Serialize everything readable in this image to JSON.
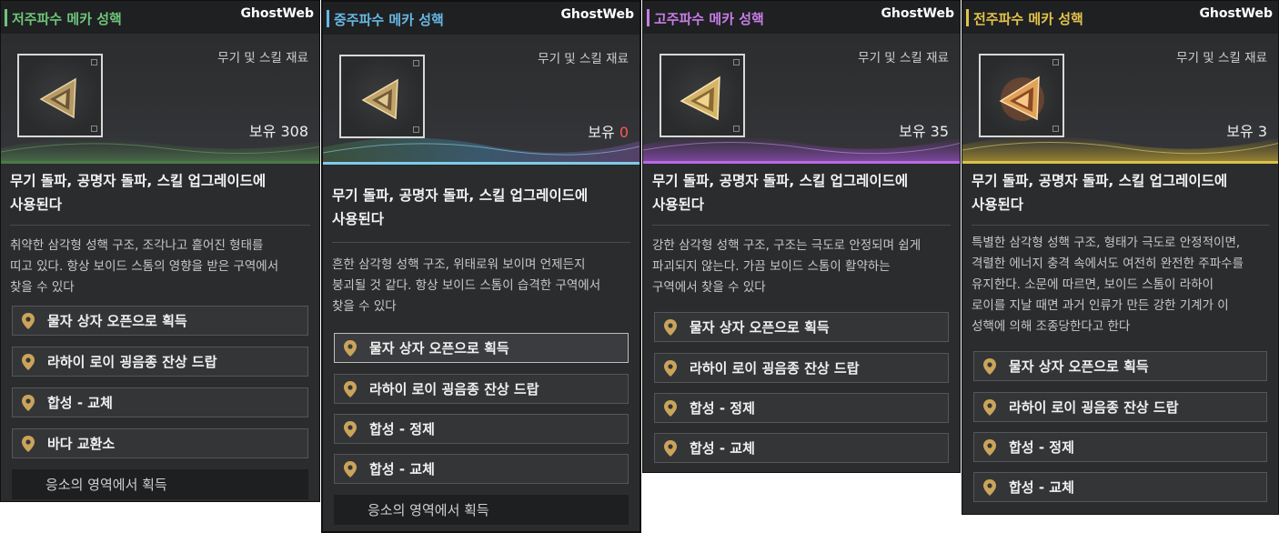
{
  "watermark": "GhostWeb",
  "colors": {
    "card1_accent": "#6ec47a",
    "card2_accent": "#66b8e4",
    "card3_accent": "#c77de6",
    "card4_accent": "#e2c24c",
    "pin": "#c9a45a"
  },
  "cards": [
    {
      "title": "저주파수 메카 성핵",
      "category": "무기 및 스킬 재료",
      "owned_label": "보유",
      "owned_value": "308",
      "desc_line1": "무기 돌파, 공명자 돌파, 스킬 업그레이드에",
      "desc_line2": "사용된다",
      "sub_lines": [
        "취약한 삼각형 성핵 구조, 조각나고 흩어진 형태를",
        "띠고 있다. 항상 보이드 스톰의 영향을 받은 구역에서",
        "찾을 수 있다"
      ],
      "sources": [
        "물자 상자 오픈으로 획득",
        "라하이 로이 굉음종 잔상 드랍",
        "합성 - 교체",
        "바다 교환소"
      ],
      "extra_source": "응소의 영역에서 획득"
    },
    {
      "title": "중주파수 메카 성핵",
      "category": "무기 및 스킬 재료",
      "owned_label": "보유",
      "owned_value": "0",
      "desc_line1": "무기 돌파, 공명자 돌파, 스킬 업그레이드에",
      "desc_line2": "사용된다",
      "sub_lines": [
        "흔한 삼각형 성핵 구조, 위태로워 보이며 언제든지",
        "붕괴될 것 같다. 항상 보이드 스톰이 습격한 구역에서",
        "찾을 수 있다"
      ],
      "sources": [
        "물자 상자 오픈으로 획득",
        "라하이 로이 굉음종 잔상 드랍",
        "합성 - 정제",
        "합성 - 교체"
      ],
      "extra_source": "응소의 영역에서 획득"
    },
    {
      "title": "고주파수 메카 성핵",
      "category": "무기 및 스킬 재료",
      "owned_label": "보유",
      "owned_value": "35",
      "desc_line1": "무기 돌파, 공명자 돌파, 스킬 업그레이드에",
      "desc_line2": "사용된다",
      "sub_lines": [
        "강한 삼각형 성핵 구조, 구조는 극도로 안정되며 쉽게",
        "파괴되지 않는다. 가끔 보이드 스톰이 활약하는",
        "구역에서 찾을 수 있다"
      ],
      "sources": [
        "물자 상자 오픈으로 획득",
        "라하이 로이 굉음종 잔상 드랍",
        "합성 - 정제",
        "합성 - 교체"
      ]
    },
    {
      "title": "전주파수 메카 성핵",
      "category": "무기 및 스킬 재료",
      "owned_label": "보유",
      "owned_value": "3",
      "desc_line1": "무기 돌파, 공명자 돌파, 스킬 업그레이드에",
      "desc_line2": "사용된다",
      "sub_lines": [
        "특별한 삼각형 성핵 구조, 형태가 극도로 안정적이면,",
        "격렬한 에너지 충격 속에서도 여전히 완전한 주파수를",
        "유지한다. 소문에 따르면, 보이드 스톰이 라하이",
        "로이를 지날 때면 과거 인류가 만든 강한 기계가 이",
        "성핵에 의해 조종당한다고 한다"
      ],
      "sources": [
        "물자 상자 오픈으로 획득",
        "라하이 로이 굉음종 잔상 드랍",
        "합성 - 정제",
        "합성 - 교체"
      ]
    }
  ]
}
